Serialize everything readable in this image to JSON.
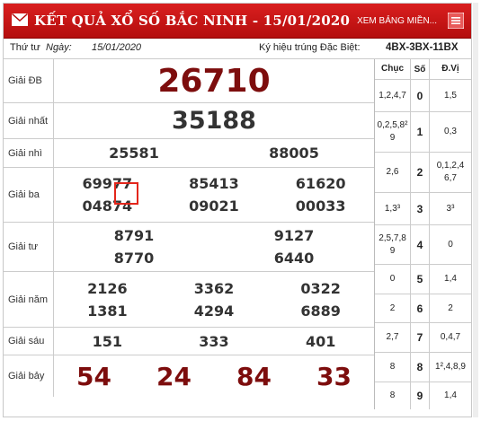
{
  "header": {
    "title": "KẾT QUẢ XỔ SỐ BẮC NINH - 15/01/2020",
    "more_link": "XEM BẢNG MIỀN...",
    "accent": "#c4161c"
  },
  "info": {
    "day": "Thứ tư",
    "date_label": "Ngày:",
    "date": "15/01/2020",
    "code_label": "Ký hiệu trúng Đặc Biệt:",
    "code": "4BX-3BX-11BX"
  },
  "prizes": [
    {
      "label": "Giải ĐB",
      "rows": [
        [
          "26710"
        ]
      ]
    },
    {
      "label": "Giải nhất",
      "rows": [
        [
          "35188"
        ]
      ]
    },
    {
      "label": "Giải nhì",
      "rows": [
        [
          "25581",
          "88005"
        ]
      ]
    },
    {
      "label": "Giải ba",
      "rows": [
        [
          "69977",
          "85413",
          "61620"
        ],
        [
          "04874",
          "09021",
          "00033"
        ]
      ]
    },
    {
      "label": "Giải tư",
      "rows": [
        [
          "8791",
          "9127"
        ],
        [
          "8770",
          "6440"
        ]
      ]
    },
    {
      "label": "Giải năm",
      "rows": [
        [
          "2126",
          "3362",
          "0322"
        ],
        [
          "1381",
          "4294",
          "6889"
        ]
      ]
    },
    {
      "label": "Giải sáu",
      "rows": [
        [
          "151",
          "333",
          "401"
        ]
      ]
    },
    {
      "label": "Giải bảy",
      "rows": [
        [
          "54",
          "24",
          "84",
          "33"
        ]
      ]
    }
  ],
  "stats": {
    "headers": [
      "Chục",
      "Số",
      "Đ.Vị"
    ],
    "rows": [
      {
        "chuc": "1,2,4,7",
        "so": "0",
        "dvi": "1,5"
      },
      {
        "chuc": "0,2,5,8² 9",
        "so": "1",
        "dvi": "0,3"
      },
      {
        "chuc": "2,6",
        "so": "2",
        "dvi": "0,1,2,4 6,7"
      },
      {
        "chuc": "1,3³",
        "so": "3",
        "dvi": "3³"
      },
      {
        "chuc": "2,5,7,8 9",
        "so": "4",
        "dvi": "0"
      },
      {
        "chuc": "0",
        "so": "5",
        "dvi": "1,4"
      },
      {
        "chuc": "2",
        "so": "6",
        "dvi": "2"
      },
      {
        "chuc": "2,7",
        "so": "7",
        "dvi": "0,4,7"
      },
      {
        "chuc": "8",
        "so": "8",
        "dvi": "1²,4,8,9"
      },
      {
        "chuc": "8",
        "so": "9",
        "dvi": "1,4"
      }
    ]
  }
}
